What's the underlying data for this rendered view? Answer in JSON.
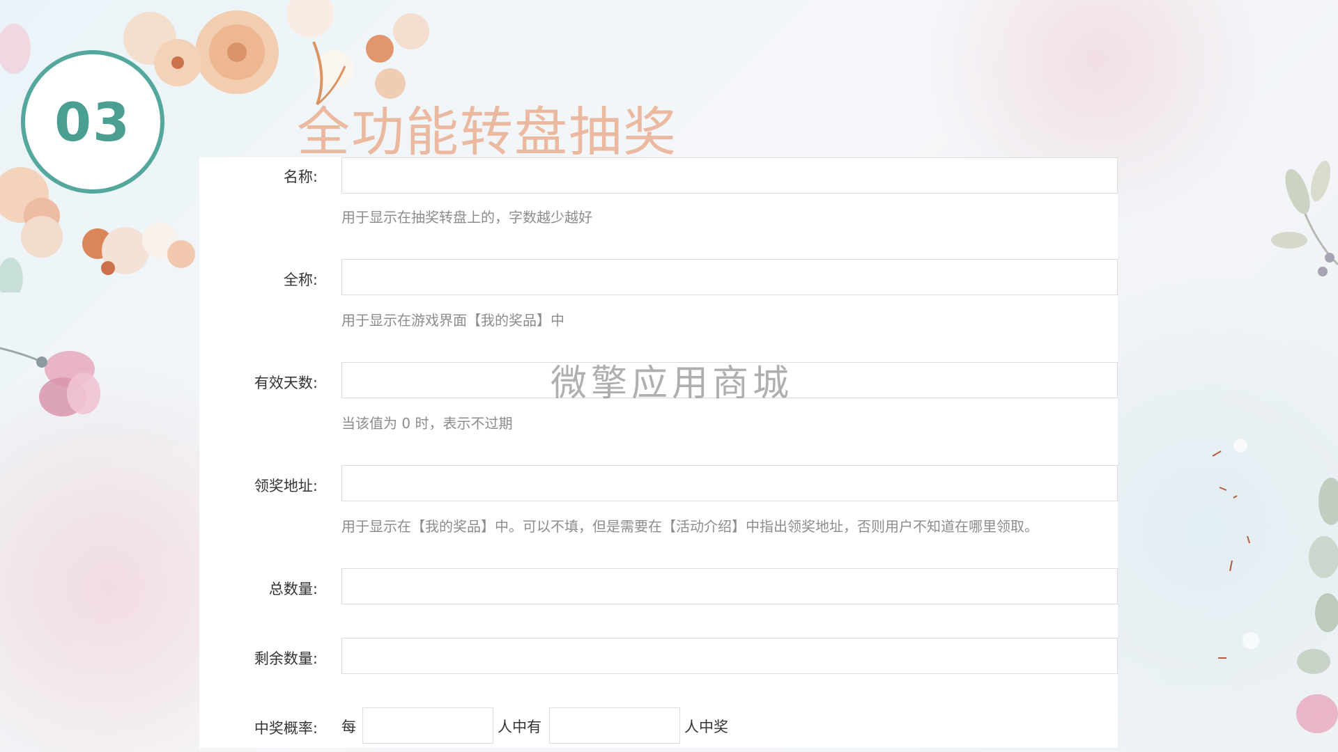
{
  "badge": {
    "number": "03"
  },
  "title": "全功能转盘抽奖",
  "watermark": "微擎应用商城",
  "form": {
    "name": {
      "label": "名称:",
      "help": "用于显示在抽奖转盘上的，字数越少越好",
      "value": ""
    },
    "full_name": {
      "label": "全称:",
      "help": "用于显示在游戏界面【我的奖品】中",
      "value": ""
    },
    "valid_days": {
      "label": "有效天数:",
      "help": "当该值为 0 时，表示不过期",
      "value": ""
    },
    "claim_address": {
      "label": "领奖地址:",
      "help": "用于显示在【我的奖品】中。可以不填，但是需要在【活动介绍】中指出领奖地址，否则用户不知道在哪里领取。",
      "value": ""
    },
    "total": {
      "label": "总数量:",
      "value": ""
    },
    "remaining": {
      "label": "剩余数量:",
      "value": ""
    },
    "probability": {
      "label": "中奖概率:",
      "prefix": "每",
      "middle": "人中有",
      "suffix": "人中奖",
      "people_value": "",
      "winners_value": ""
    }
  },
  "colors": {
    "accent_teal": "#54a79c",
    "title_peach": "#eab9a0",
    "help_gray": "#8c8c8c"
  }
}
